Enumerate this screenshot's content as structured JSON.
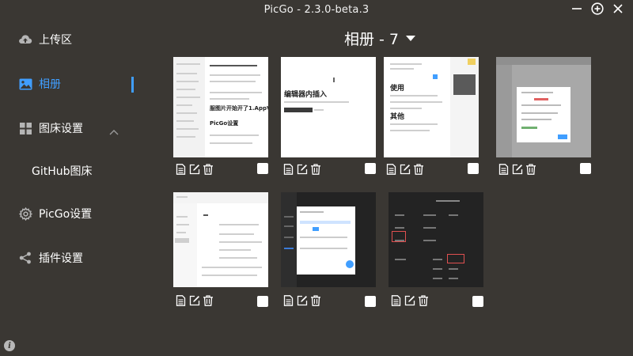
{
  "window": {
    "title": "PicGo - 2.3.0-beta.3"
  },
  "sidebar": {
    "items": [
      {
        "label": "上传区",
        "icon": "cloud-upload-icon"
      },
      {
        "label": "相册",
        "icon": "image-icon"
      },
      {
        "label": "图床设置",
        "icon": "grid-icon"
      },
      {
        "label": "GitHub图床"
      },
      {
        "label": "PicGo设置",
        "icon": "gear-icon"
      },
      {
        "label": "插件设置",
        "icon": "share-icon"
      }
    ]
  },
  "album": {
    "title": "相册 - 7"
  },
  "thumbnails": [
    {
      "text": [
        "服图片开始开了1.AppVeyorPicGo",
        "PicGo设置"
      ]
    },
    {
      "text": [
        "编辑器内插入"
      ]
    },
    {
      "text": [
        "使用",
        "其他"
      ]
    },
    {
      "text": []
    },
    {
      "text": []
    },
    {
      "text": []
    },
    {
      "text": []
    }
  ],
  "colors": {
    "background": "#3a3733",
    "accent": "#409eff",
    "text": "#ffffff"
  }
}
